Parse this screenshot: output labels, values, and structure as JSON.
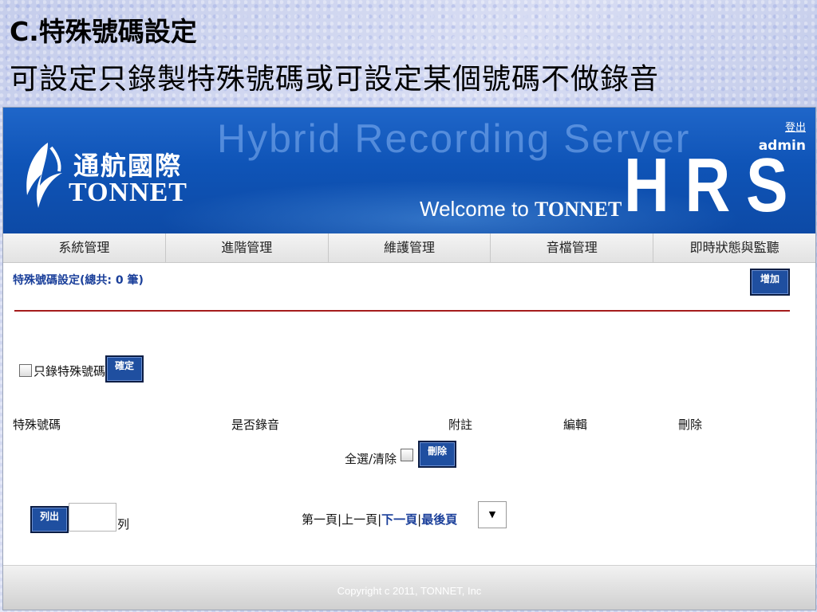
{
  "slide": {
    "title": "C.特殊號碼設定",
    "subtitle": "可設定只錄製特殊號碼或可設定某個號碼不做錄音"
  },
  "banner": {
    "logo_cn": "通航國際",
    "logo_en": "TONNET",
    "product_line": "Hybrid Recording Server",
    "welcome_prefix": "Welcome to",
    "welcome_brand": "TONNET",
    "product_mark": "HRS",
    "logout_label": "登出",
    "user": "admin"
  },
  "menu": {
    "items": [
      {
        "label": "系統管理"
      },
      {
        "label": "進階管理"
      },
      {
        "label": "維護管理"
      },
      {
        "label": "音檔管理"
      },
      {
        "label": "即時狀態與監聽"
      }
    ]
  },
  "content": {
    "section_title": "特殊號碼設定(總共: 0 筆)",
    "add_label": "增加",
    "only_special_label": "只錄特殊號碼",
    "confirm_label": "確定",
    "columns": [
      "特殊號碼",
      "是否錄音",
      "附註",
      "編輯",
      "刪除"
    ],
    "select_all_label": "全選/清除",
    "delete_label": "刪除",
    "list_label": "列出",
    "rows_value": "",
    "rows_unit": "列",
    "pager": {
      "first": "第一頁",
      "prev": "上一頁",
      "next": "下一頁",
      "last": "最後頁",
      "separator": "|"
    },
    "page_select_glyph": "▼"
  },
  "footer": {
    "copyright": "Copyright c 2011, TONNET, Inc"
  }
}
